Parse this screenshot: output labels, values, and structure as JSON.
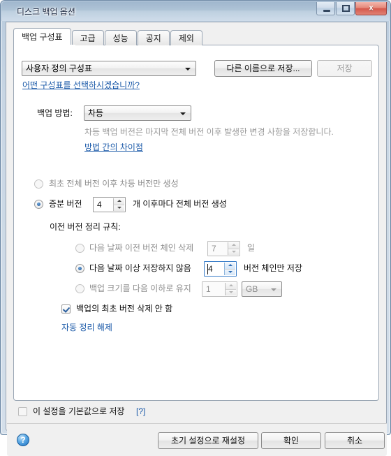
{
  "window": {
    "title": "디스크 백업 옵션",
    "buttons": {
      "minimize": "minimize-button",
      "restore": "restore-button",
      "close_glyph": "x"
    }
  },
  "tabs": [
    {
      "label": "백업 구성표",
      "active": true
    },
    {
      "label": "고급",
      "active": false
    },
    {
      "label": "성능",
      "active": false
    },
    {
      "label": "공지",
      "active": false
    },
    {
      "label": "제외",
      "active": false
    }
  ],
  "scheme": {
    "combo_value": "사용자 정의 구성표",
    "save_as_button": "다른 이름으로 저장...",
    "save_button": "저장",
    "help_link": "어떤 구성표를 선택하시겠습니까?"
  },
  "method": {
    "label": "백업 방법:",
    "combo_value": "차등",
    "description": "차등 백업 버전은 마지막 전체 버전 이후 발생한 변경 사항을 저장합니다.",
    "link": "방법 간의 차이점"
  },
  "version_options": {
    "option_full_only": "최초 전체 버전 이후 차등 버전만 생성",
    "option_incremental_prefix": "증분 버전",
    "incremental_count": "4",
    "option_incremental_suffix": "개 이후마다 전체 버전 생성"
  },
  "cleanup": {
    "title": "이전 버전 정리 규칙:",
    "rules": [
      {
        "label": "다음 날짜 이전 버전 체인 삭제",
        "value": "7",
        "unit": "일",
        "selected": false,
        "enabled": false
      },
      {
        "label": "다음 날짜 이상 저장하지 않음",
        "value": "4",
        "unit": "버전 체인만 저장",
        "selected": true,
        "enabled": true
      },
      {
        "label": "백업 크기를 다음 이하로 유지",
        "value": "1",
        "unit_combo": "GB",
        "selected": false,
        "enabled": false
      }
    ],
    "keep_first_checkbox": "백업의 최초 버전 삭제 안 함",
    "disable_autoclean_link": "자동 정리 해제"
  },
  "footer": {
    "default_checkbox": "이 설정을 기본값으로 저장",
    "help_marker": "[?]",
    "help_icon_glyph": "?",
    "reset_button": "초기 설정으로 재설정",
    "ok_button": "확인",
    "cancel_button": "취소"
  },
  "colors": {
    "link": "#1a59a8",
    "accent": "#2a5f9e",
    "dialog_bg": "#f0f0f0",
    "panel_bg": "#ffffff"
  }
}
